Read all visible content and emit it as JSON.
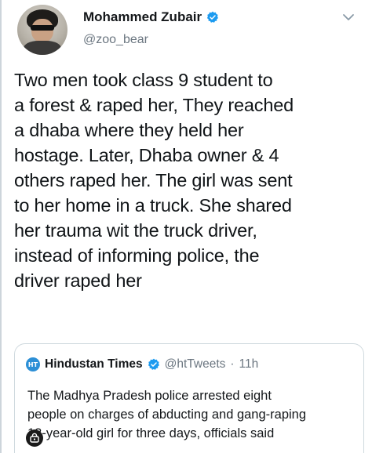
{
  "author": {
    "display_name": "Mohammed Zubair",
    "handle": "@zoo_bear",
    "avatar_icon": "user-avatar-photo",
    "verified": true,
    "verified_color": "#1d9bf0"
  },
  "tweet": {
    "text": "Two men took class 9 student to\na forest & raped her, They reached\na dhaba where they held her\nhostage. Later, Dhaba owner & 4\nothers raped her. The girl was sent\nto her home in a truck. She shared\nher trauma wit the truck driver,\ninstead of informing police, the\ndriver raped her"
  },
  "quoted_tweet": {
    "logo_text": "HT",
    "display_name": "Hindustan Times",
    "handle": "@htTweets",
    "separator": "·",
    "time": "11h",
    "text": "The Madhya Pradesh police arrested eight\npeople on charges of abducting and gang-raping\n13-year-old girl for three days, officials said"
  },
  "icons": {
    "menu": "chevron-down-icon",
    "share": "share-icon"
  },
  "colors": {
    "text_primary": "#14171a",
    "text_secondary": "#6b7680",
    "border": "#cfd9de",
    "verified": "#1d9bf0",
    "ht_logo": "#2c8fd6"
  }
}
